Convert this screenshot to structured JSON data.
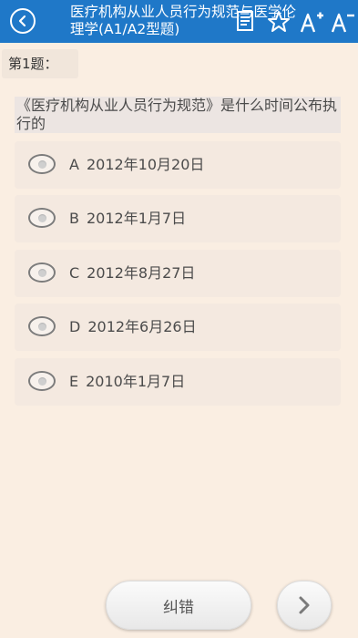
{
  "header": {
    "title": "医疗机构从业人员行为规范与医学伦理学(A1/A2型题)",
    "bg_color": "#1f78c8",
    "icons": [
      "back-icon",
      "note-icon",
      "star-icon",
      "font-increase-icon",
      "font-decrease-icon"
    ]
  },
  "question": {
    "number_label": "第1题：",
    "text": "《医疗机构从业人员行为规范》是什么时间公布执行的",
    "options": [
      {
        "letter": "A",
        "text": "2012年10月20日"
      },
      {
        "letter": "B",
        "text": "2012年1月7日"
      },
      {
        "letter": "C",
        "text": "2012年8月27日"
      },
      {
        "letter": "D",
        "text": "2012年6月26日"
      },
      {
        "letter": "E",
        "text": "2010年1月7日"
      }
    ]
  },
  "footer": {
    "report_label": "纠错",
    "next_icon": "chevron-right-icon"
  }
}
